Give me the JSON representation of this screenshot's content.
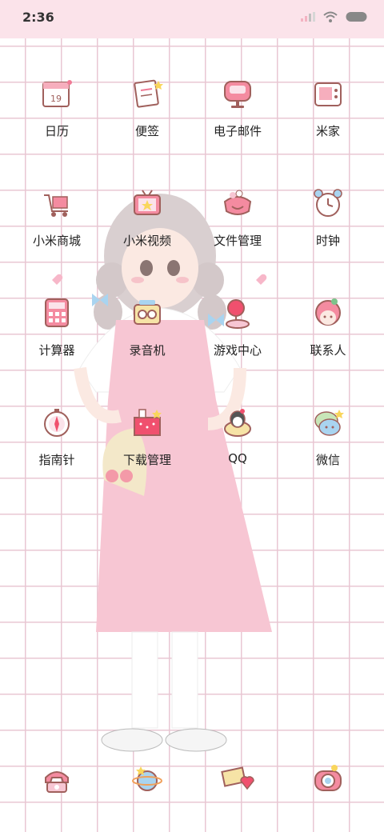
{
  "status_bar": {
    "time": "2:36",
    "icons": [
      "signal-icon",
      "wifi-icon",
      "battery-icon"
    ]
  },
  "apps": [
    {
      "label": "日历",
      "icon": "calendar-icon"
    },
    {
      "label": "便签",
      "icon": "notes-icon"
    },
    {
      "label": "电子邮件",
      "icon": "email-icon"
    },
    {
      "label": "米家",
      "icon": "mihome-icon"
    },
    {
      "label": "小米商城",
      "icon": "mall-icon"
    },
    {
      "label": "小米视频",
      "icon": "video-icon"
    },
    {
      "label": "文件管理",
      "icon": "file-manager-icon"
    },
    {
      "label": "时钟",
      "icon": "clock-icon"
    },
    {
      "label": "计算器",
      "icon": "calculator-icon"
    },
    {
      "label": "录音机",
      "icon": "recorder-icon"
    },
    {
      "label": "游戏中心",
      "icon": "game-center-icon"
    },
    {
      "label": "联系人",
      "icon": "contacts-icon"
    },
    {
      "label": "指南针",
      "icon": "compass-icon"
    },
    {
      "label": "下载管理",
      "icon": "download-icon"
    },
    {
      "label": "QQ",
      "icon": "qq-icon"
    },
    {
      "label": "微信",
      "icon": "wechat-icon"
    }
  ],
  "calendar_icon_text": "19",
  "dock": [
    "phone-icon",
    "browser-icon",
    "messages-icon",
    "camera-icon"
  ],
  "colors": {
    "accent": "#e97b95",
    "grid": "#e9c7d3",
    "status_bg": "#fbe3ea"
  }
}
